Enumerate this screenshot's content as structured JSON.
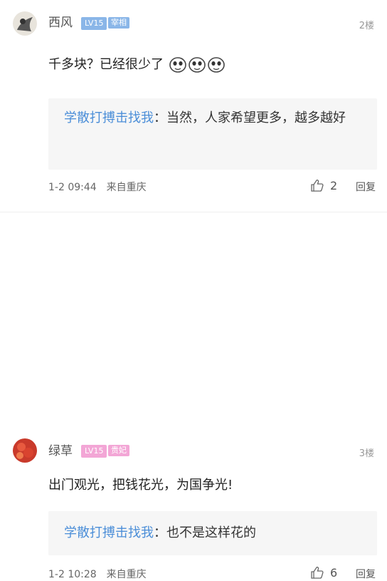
{
  "comments": [
    {
      "username": "西风",
      "level": "LV15",
      "rank": "宰相",
      "floor": "2楼",
      "content": "千多块？已经很少了",
      "emoji_count": 3,
      "quote": {
        "name": "学散打搏击找我",
        "sep": "：",
        "text": "当然，人家希望更多，越多越好"
      },
      "time": "1-2 09:44",
      "location": "来自重庆",
      "likes": "2",
      "reply_label": "回复",
      "colors": {
        "level_bg": "#8ab6e8",
        "rank_bg": "#8ab6e8"
      }
    },
    {
      "username": "绿草",
      "level": "LV15",
      "rank": "贵妃",
      "floor": "3楼",
      "content": "出门观光，把钱花光，为国争光!",
      "quote": {
        "name": "学散打搏击找我",
        "sep": "：",
        "text": "也不是这样花的"
      },
      "time": "1-2 10:28",
      "location": "来自重庆",
      "likes": "6",
      "reply_label": "回复",
      "colors": {
        "level_bg": "#f3a6d6",
        "rank_bg": "#f3a6d6"
      }
    }
  ]
}
